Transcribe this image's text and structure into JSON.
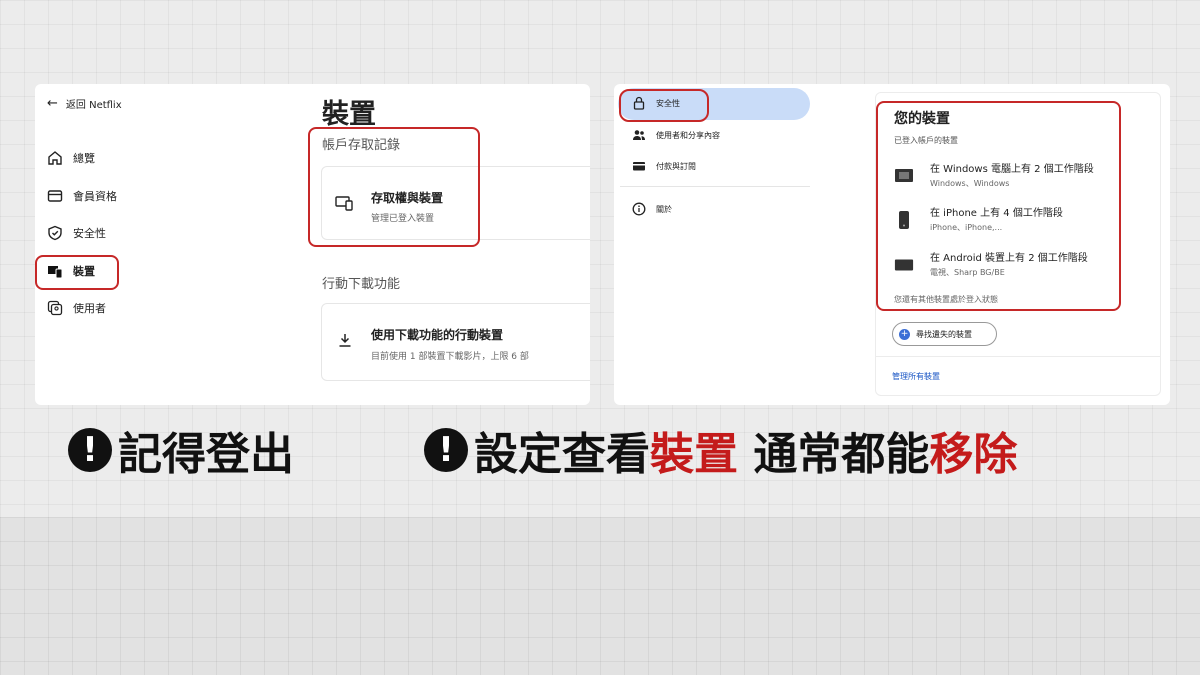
{
  "left_panel": {
    "back_label": "返回 Netflix",
    "nav": [
      {
        "label": "總覽",
        "icon": "home-icon"
      },
      {
        "label": "會員資格",
        "icon": "card-icon"
      },
      {
        "label": "安全性",
        "icon": "shield-icon"
      },
      {
        "label": "裝置",
        "icon": "devices-icon"
      },
      {
        "label": "使用者",
        "icon": "profiles-icon"
      }
    ],
    "page_title": "裝置",
    "access_section": {
      "label": "帳戶存取記錄",
      "card_title": "存取權與裝置",
      "card_subtitle": "管理已登入裝置"
    },
    "download_section": {
      "label": "行動下載功能",
      "card_title": "使用下載功能的行動裝置",
      "card_subtitle": "目前使用 1 部裝置下載影片，上限 6 部"
    }
  },
  "right_panel": {
    "nav": [
      {
        "label": "安全性",
        "icon": "lock-icon"
      },
      {
        "label": "使用者和分享內容",
        "icon": "people-icon"
      },
      {
        "label": "付款與訂閱",
        "icon": "card-icon"
      },
      {
        "label": "關於",
        "icon": "info-icon"
      }
    ],
    "devices": {
      "title": "您的裝置",
      "subtitle": "已登入帳戶的裝置",
      "items": [
        {
          "name": "在 Windows 電腦上有 2 個工作階段",
          "detail": "Windows、Windows",
          "icon": "computer-icon"
        },
        {
          "name": "在 iPhone 上有 4 個工作階段",
          "detail": "iPhone、iPhone,...",
          "icon": "phone-icon"
        },
        {
          "name": "在 Android 裝置上有 2 個工作階段",
          "detail": "電視、Sharp BG/BE",
          "icon": "tv-icon"
        }
      ],
      "note": "您還有其他裝置處於登入狀態",
      "find_button": "尋找遺失的裝置",
      "manage_link": "管理所有裝置"
    }
  },
  "caption": {
    "left": "記得登出",
    "right_part1": "設定查看",
    "right_red1": "裝置",
    "right_part2": " 通常都能",
    "right_red2": "移除"
  },
  "colors": {
    "highlight": "#c62828",
    "caption_red": "#c41b1b",
    "active_nav": "#c9dcf8"
  }
}
